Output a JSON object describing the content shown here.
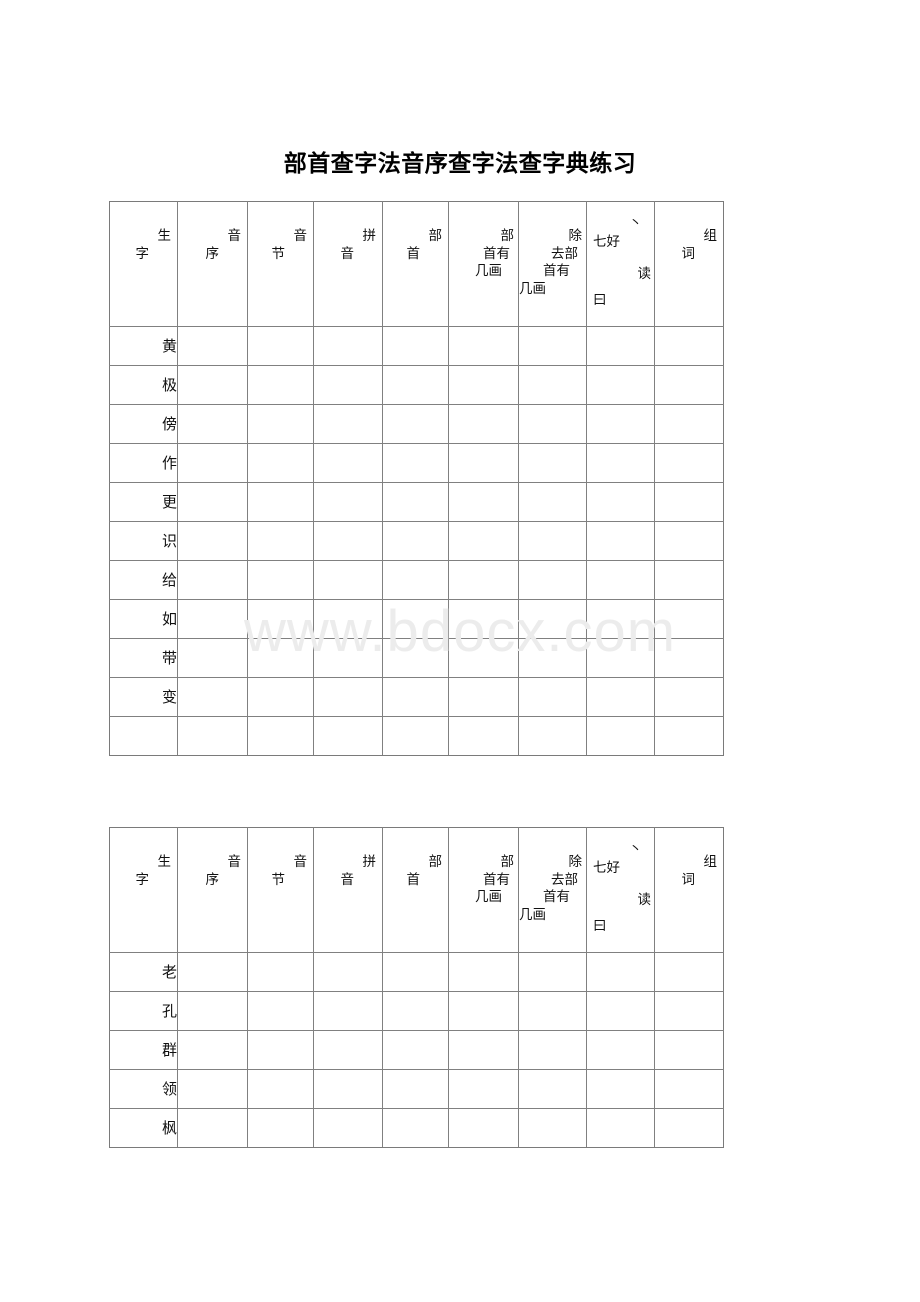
{
  "document": {
    "title": "部首查字法音序查字法查字典练习",
    "watermark": "www.bdocx.com",
    "page_background": "#ffffff",
    "grid_line_color": "#808080"
  },
  "table_header": {
    "columns": [
      {
        "id": "sheng-zi",
        "lines": [
          "生",
          "字"
        ]
      },
      {
        "id": "yin-xu",
        "lines": [
          "音",
          "序"
        ]
      },
      {
        "id": "yin-jie",
        "lines": [
          "音",
          "节"
        ]
      },
      {
        "id": "pin-yin",
        "lines": [
          "拼",
          "音"
        ]
      },
      {
        "id": "bu-shou",
        "lines": [
          "部",
          "首"
        ]
      },
      {
        "id": "bu-shou-you-ji-hua",
        "lines": [
          "部",
          "首有",
          "几画"
        ]
      },
      {
        "id": "chu-qu-bu-shou-you-ji-hua",
        "lines": [
          "除",
          "去部",
          "首有",
          "几画"
        ]
      },
      {
        "id": "hao-du",
        "artifact": true,
        "tick": "丶",
        "main": "七好",
        "read": "读",
        "extra": "曰"
      },
      {
        "id": "zu-ci",
        "lines": [
          "组",
          "词"
        ]
      }
    ]
  },
  "table_1": {
    "name": "练习表一",
    "rows": [
      {
        "char": "黄"
      },
      {
        "char": "极"
      },
      {
        "char": "傍"
      },
      {
        "char": "作"
      },
      {
        "char": "更"
      },
      {
        "char": "识"
      },
      {
        "char": "给"
      },
      {
        "char": "如"
      },
      {
        "char": "带"
      },
      {
        "char": "变"
      },
      {
        "char": ""
      }
    ]
  },
  "table_2": {
    "name": "练习表二",
    "rows": [
      {
        "char": "老"
      },
      {
        "char": "孔"
      },
      {
        "char": "群"
      },
      {
        "char": "领"
      },
      {
        "char": "枫"
      }
    ]
  }
}
